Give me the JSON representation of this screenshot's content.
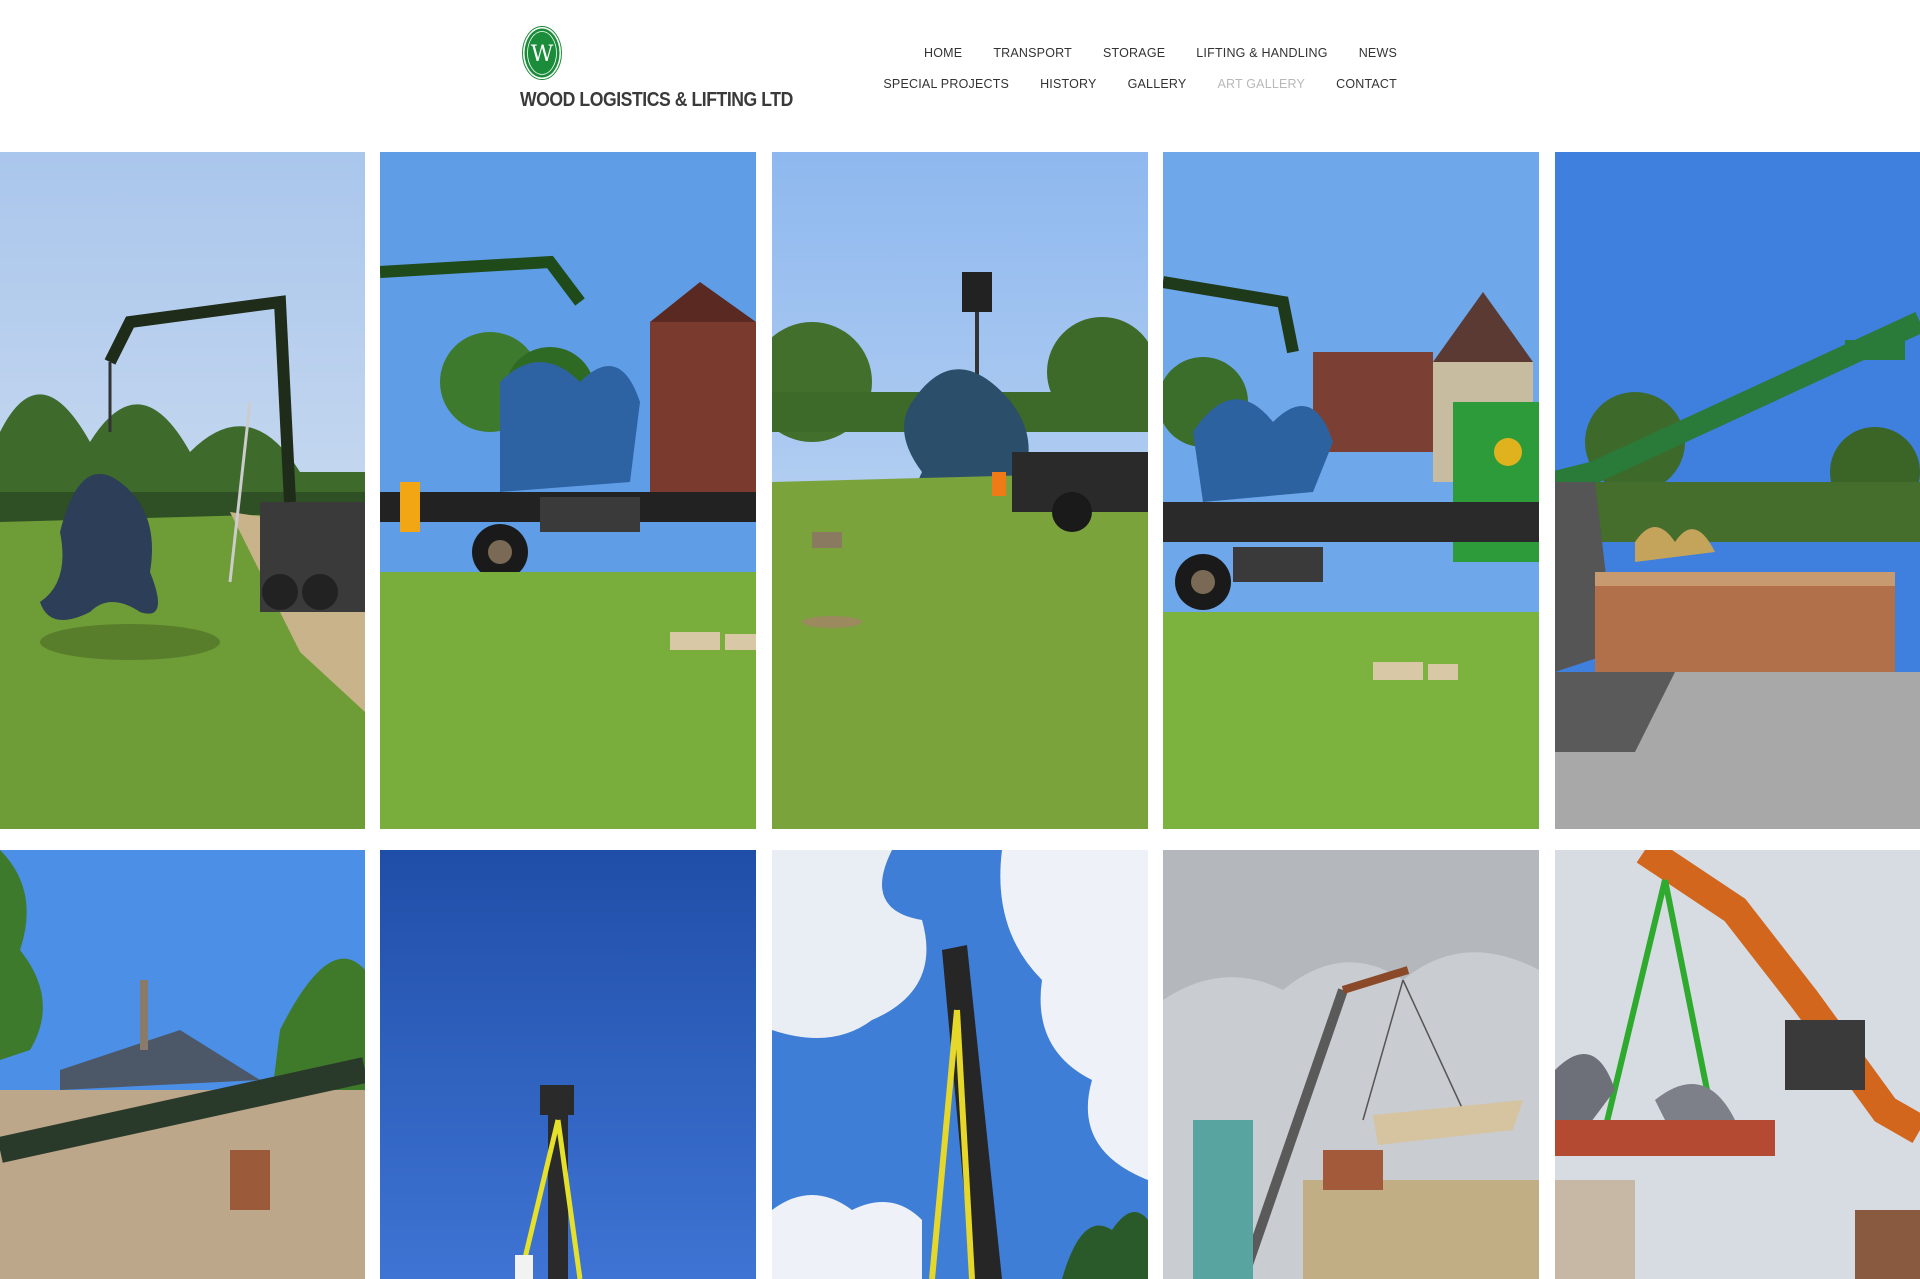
{
  "brand": {
    "logo_letter": "W",
    "name": "WOOD LOGISTICS & LIFTING LTD",
    "logo_color": "#1a8c3a"
  },
  "nav": {
    "row1": [
      {
        "label": "HOME",
        "key": "home"
      },
      {
        "label": "TRANSPORT",
        "key": "transport"
      },
      {
        "label": "STORAGE",
        "key": "storage"
      },
      {
        "label": "LIFTING & HANDLING",
        "key": "lifting-handling"
      },
      {
        "label": "NEWS",
        "key": "news"
      }
    ],
    "row2": [
      {
        "label": "SPECIAL PROJECTS",
        "key": "special-projects"
      },
      {
        "label": "HISTORY",
        "key": "history"
      },
      {
        "label": "GALLERY",
        "key": "gallery"
      },
      {
        "label": "ART GALLERY",
        "key": "art-gallery",
        "active": true
      },
      {
        "label": "CONTACT",
        "key": "contact"
      }
    ],
    "active_color": "#b8b8b8"
  },
  "gallery": {
    "photos": [
      {
        "subject": "crane lorry lifting blue sculpture on lawn"
      },
      {
        "subject": "blue sculpture on flatbed lorry, worker in hi-vis"
      },
      {
        "subject": "sculpture suspended from crane over lawn"
      },
      {
        "subject": "green lorry with sculpture beside house"
      },
      {
        "subject": "green crane arm over brick planter"
      },
      {
        "subject": "crane arm across stone wall"
      },
      {
        "subject": "crane tip against deep blue sky"
      },
      {
        "subject": "crane with yellow straps, cloudy sky"
      },
      {
        "subject": "crane lifting wooden crate over buildings"
      },
      {
        "subject": "orange excavator lifting load with green straps"
      }
    ]
  }
}
